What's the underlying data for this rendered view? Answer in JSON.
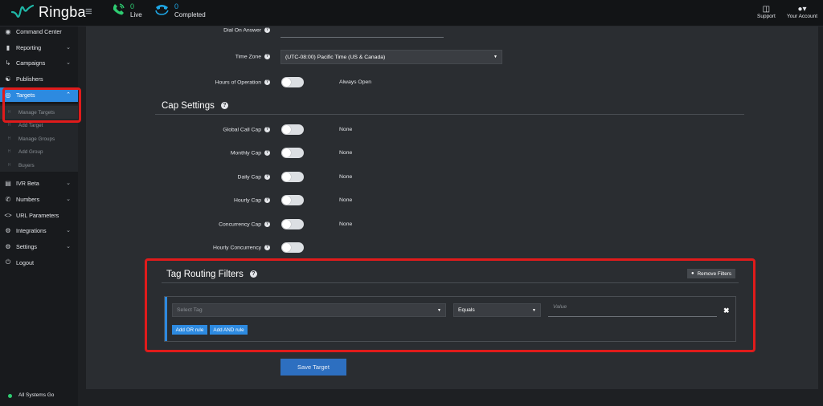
{
  "app": {
    "name": "Ringba"
  },
  "header": {
    "live": {
      "count": "0",
      "label": "Live"
    },
    "completed": {
      "count": "0",
      "label": "Completed"
    },
    "support_label": "Support",
    "account_label": "Your Account"
  },
  "sidebar": {
    "items": [
      {
        "label": "Command Center"
      },
      {
        "label": "Reporting"
      },
      {
        "label": "Campaigns"
      },
      {
        "label": "Publishers"
      },
      {
        "label": "Targets"
      },
      {
        "label": "IVR Beta"
      },
      {
        "label": "Numbers"
      },
      {
        "label": "URL Parameters"
      },
      {
        "label": "Integrations"
      },
      {
        "label": "Settings"
      },
      {
        "label": "Logout"
      }
    ],
    "sub_items": [
      {
        "label": "Manage Targets"
      },
      {
        "label": "Add Target"
      },
      {
        "label": "Manage Groups"
      },
      {
        "label": "Add Group"
      },
      {
        "label": "Buyers"
      }
    ],
    "status": "All Systems Go"
  },
  "form": {
    "dial_on_answer_label": "Dial On Answer",
    "time_zone_label": "Time Zone",
    "time_zone_value": "(UTC-08:00) Pacific Time (US & Canada)",
    "hours_label": "Hours of Operation",
    "hours_value": "Always Open"
  },
  "cap_settings": {
    "title": "Cap Settings",
    "rows": [
      {
        "label": "Global Call Cap",
        "value": "None"
      },
      {
        "label": "Monthly Cap",
        "value": "None"
      },
      {
        "label": "Daily Cap",
        "value": "None"
      },
      {
        "label": "Hourly Cap",
        "value": "None"
      },
      {
        "label": "Concurrency Cap",
        "value": "None"
      },
      {
        "label": "Hourly Concurrency",
        "value": ""
      }
    ]
  },
  "tag_routing": {
    "title": "Tag Routing Filters",
    "remove_label": "Remove Filters",
    "select_tag_placeholder": "Select Tag",
    "operator_value": "Equals",
    "value_placeholder": "Value",
    "add_or_label": "Add OR rule",
    "add_and_label": "Add AND rule"
  },
  "save_label": "Save Target",
  "colors": {
    "accent": "#2d8ae0",
    "live": "#2ecc71",
    "highlight": "#e01b1b"
  }
}
